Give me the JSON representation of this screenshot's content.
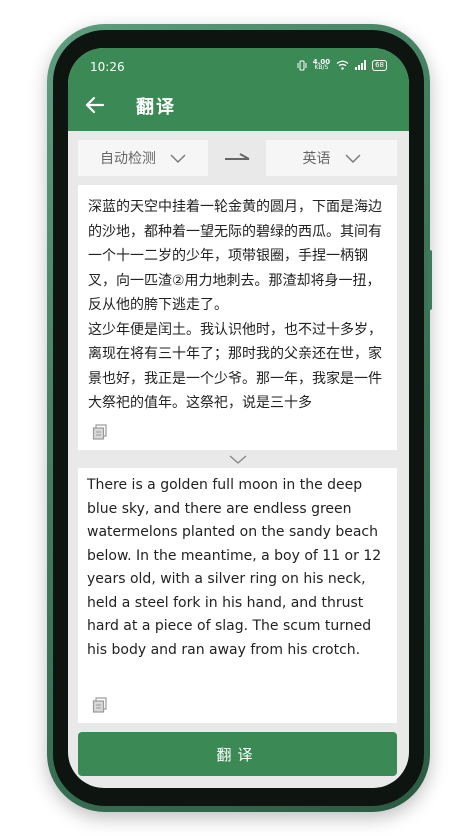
{
  "status_bar": {
    "time": "10:26",
    "net_speed_value": "4.00",
    "net_speed_unit": "KB/S",
    "battery": "68",
    "icons": [
      "vibrate-icon",
      "wifi-icon",
      "signal-icon",
      "battery-icon"
    ]
  },
  "header": {
    "title": "翻译",
    "back_icon": "back-arrow-icon"
  },
  "language": {
    "source": "自动检测",
    "target": "英语",
    "swap_icon": "arrow-right-icon",
    "dropdown_icon": "chevron-down-icon"
  },
  "source_text": "深蓝的天空中挂着一轮金黄的圆月，下面是海边的沙地，都种着一望无际的碧绿的西瓜。其间有一个十一二岁的少年，项带银圈，手捏一柄钢叉，向一匹渣②用力地刺去。那渣却将身一扭，反从他的胯下逃走了。\n这少年便是闰土。我认识他时，也不过十多岁，离现在将有三十年了；那时我的父亲还在世，家景也好，我正是一个少爷。那一年，我家是一件大祭祀的值年。这祭祀，说是三十多",
  "result_text": "There is a golden full moon in the deep blue sky, and there are endless green watermelons planted on the sandy beach below. In the meantime, a boy of 11 or 12 years old, with a silver ring on his neck, held a steel fork in his hand, and thrust hard at a piece of slag. The scum turned his body and ran away from his crotch.",
  "translate_button": "翻译",
  "colors": {
    "brand_green": "#3b8a55",
    "frame_green": "#3e7a5c",
    "background": "#e9e9e9"
  }
}
